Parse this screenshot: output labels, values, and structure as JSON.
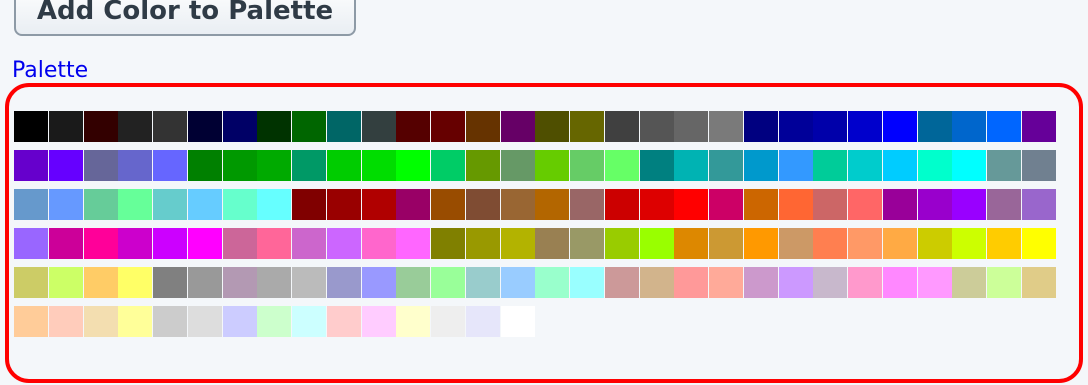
{
  "add_button_label": "Add Color to Palette",
  "palette_link_label": "Palette",
  "swatches": [
    "#000000",
    "#1a1a1a",
    "#330000",
    "#222222",
    "#333333",
    "#000033",
    "#000066",
    "#003300",
    "#006600",
    "#006666",
    "#333f3f",
    "#550000",
    "#660000",
    "#663300",
    "#660066",
    "#4f4f00",
    "#666600",
    "#404040",
    "#555555",
    "#666666",
    "#7a7a7a",
    "#000080",
    "#000099",
    "#0000aa",
    "#0000cc",
    "#0000ff",
    "#006699",
    "#0066cc",
    "#0066ff",
    "#660099",
    "#6600cc",
    "#6600ff",
    "#666699",
    "#6666cc",
    "#6666ff",
    "#008000",
    "#009900",
    "#00aa00",
    "#009966",
    "#00cc00",
    "#00dd00",
    "#00ff00",
    "#00cc66",
    "#669900",
    "#669966",
    "#66cc00",
    "#66cc66",
    "#66ff66",
    "#008080",
    "#00b3b3",
    "#339999",
    "#0099cc",
    "#3399ff",
    "#00cc99",
    "#00cccc",
    "#00ccff",
    "#00ffcc",
    "#00ffff",
    "#669999",
    "#708090",
    "#6699cc",
    "#6699ff",
    "#66cc99",
    "#66ff99",
    "#66cccc",
    "#66ccff",
    "#66ffcc",
    "#66ffff",
    "#800000",
    "#990000",
    "#b00000",
    "#990066",
    "#994c00",
    "#7f4c33",
    "#996633",
    "#b36600",
    "#996666",
    "#cc0000",
    "#dd0000",
    "#ff0000",
    "#cc0066",
    "#cc6600",
    "#ff6633",
    "#cc6666",
    "#ff6666",
    "#990099",
    "#9900cc",
    "#9900ff",
    "#996699",
    "#9966cc",
    "#9966ff",
    "#cc0099",
    "#ff0099",
    "#cc00cc",
    "#cc00ff",
    "#ff00ff",
    "#cc6699",
    "#ff6699",
    "#cc66cc",
    "#cc66ff",
    "#ff66cc",
    "#ff66ff",
    "#808000",
    "#999900",
    "#b3b300",
    "#998052",
    "#999966",
    "#99cc00",
    "#99ff00",
    "#dd8800",
    "#cc9933",
    "#ff9900",
    "#cc9966",
    "#ff7f50",
    "#ff9966",
    "#ffaa44",
    "#cccc00",
    "#ccff00",
    "#ffcc00",
    "#ffff00",
    "#cccc66",
    "#ccff66",
    "#ffcc66",
    "#ffff66",
    "#808080",
    "#999999",
    "#b399b3",
    "#aaaaaa",
    "#bbbbbb",
    "#9999cc",
    "#9999ff",
    "#99cc99",
    "#99ff99",
    "#99cccc",
    "#99ccff",
    "#99ffcc",
    "#99ffff",
    "#cc9999",
    "#d2b48c",
    "#ff9999",
    "#ffaa99",
    "#cc99cc",
    "#cc99ff",
    "#c8b8cc",
    "#ff99cc",
    "#ff88ff",
    "#ff99ff",
    "#cccc99",
    "#ccff99",
    "#e0cc88",
    "#ffcc99",
    "#ffccbb",
    "#f3deb0",
    "#ffff99",
    "#cccccc",
    "#dddddd",
    "#ccccff",
    "#ccffcc",
    "#ccffff",
    "#ffcccc",
    "#ffccff",
    "#ffffcc",
    "#eeeeee",
    "#e6e6fa",
    "#ffffff"
  ]
}
